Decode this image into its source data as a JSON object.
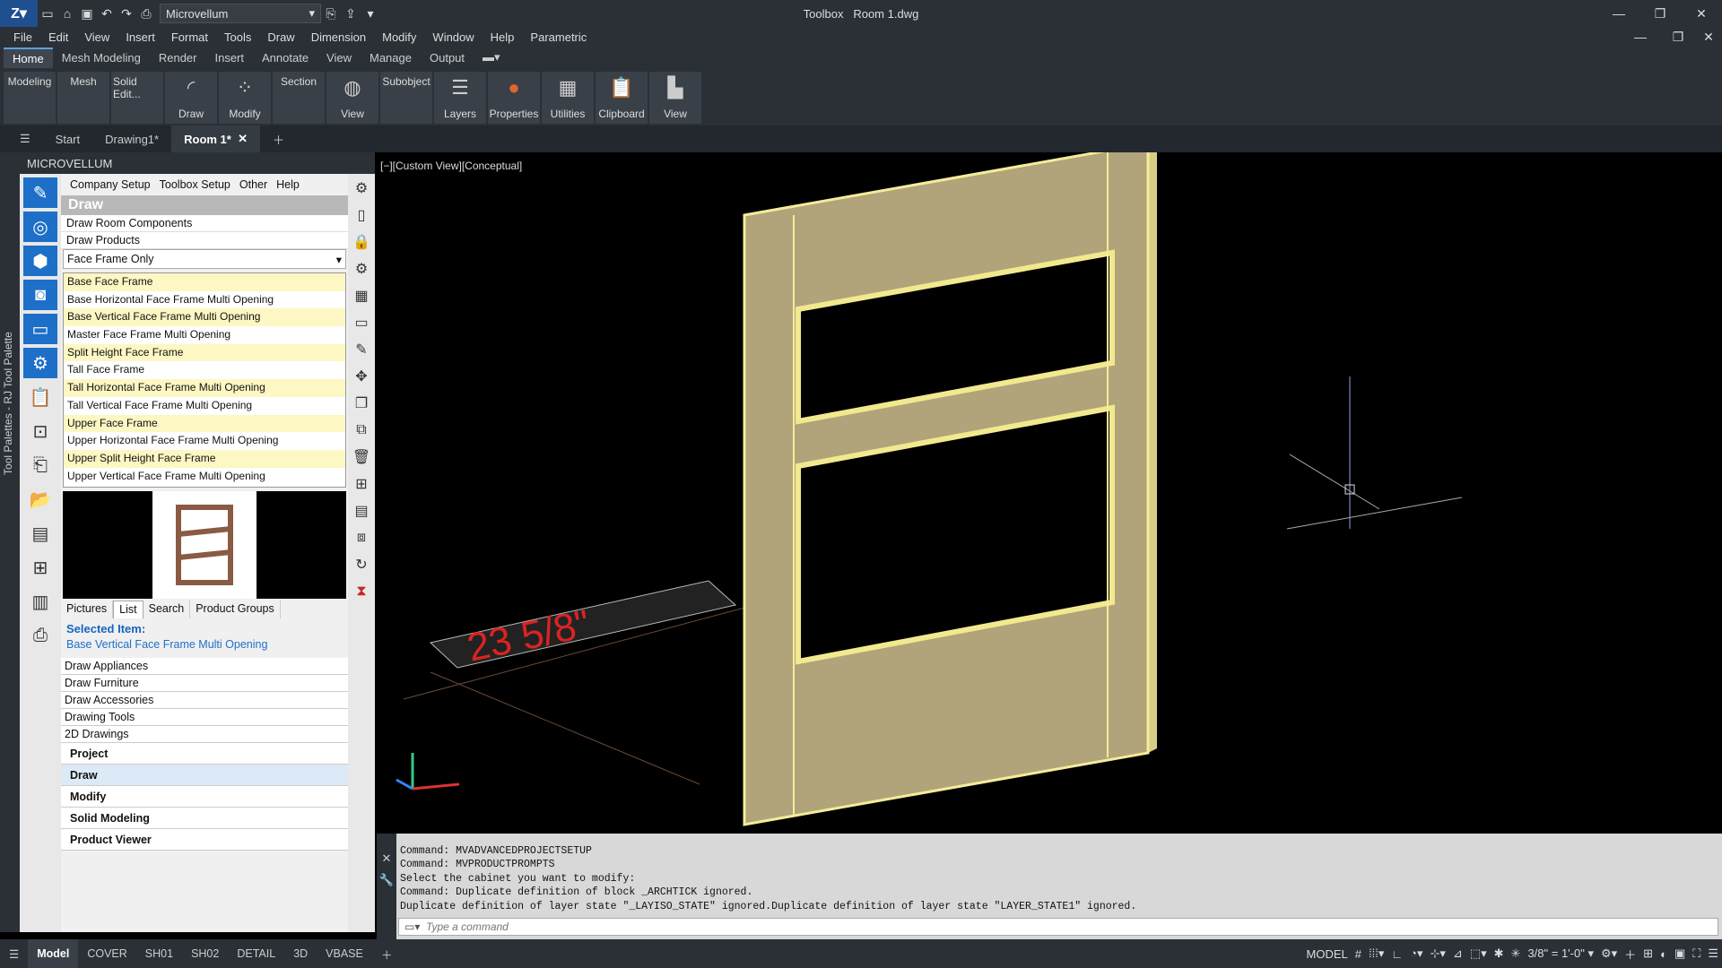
{
  "title": {
    "workspace": "Microvellum",
    "app_center": "Toolbox",
    "file": "Room 1.dwg"
  },
  "menu": [
    "File",
    "Edit",
    "View",
    "Insert",
    "Format",
    "Tools",
    "Draw",
    "Dimension",
    "Modify",
    "Window",
    "Help",
    "Parametric"
  ],
  "ribbon_tabs": [
    "Home",
    "Mesh Modeling",
    "Render",
    "Insert",
    "Annotate",
    "View",
    "Manage",
    "Output"
  ],
  "ribbon_panels": [
    "Modeling",
    "Mesh",
    "Solid Edit...",
    "Draw",
    "Modify",
    "Section",
    "View",
    "Subobject",
    "Layers",
    "Properties",
    "Utilities",
    "Clipboard",
    "View"
  ],
  "doc_tabs": [
    "Start",
    "Drawing1*",
    "Room 1*"
  ],
  "palette": {
    "header": "MICROVELLUM",
    "side_label": "Tool Palettes - RJ Tool Palette",
    "submenu": [
      "Company Setup",
      "Toolbox Setup",
      "Other",
      "Help"
    ],
    "section": "Draw",
    "draw_room": "Draw Room Components",
    "draw_products": "Draw Products",
    "filter": "Face Frame Only",
    "items": [
      "Base Face Frame",
      "Base Horizontal Face Frame Multi Opening",
      "Base Vertical Face Frame Multi Opening",
      "Master Face Frame Multi Opening",
      "Split Height Face Frame",
      "Tall Face Frame",
      "Tall Horizontal Face Frame Multi Opening",
      "Tall Vertical Face Frame Multi Opening",
      "Upper Face Frame",
      "Upper Horizontal Face Frame Multi Opening",
      "Upper Split Height Face Frame",
      "Upper Vertical Face Frame Multi Opening"
    ],
    "preview_tabs": [
      "Pictures",
      "List",
      "Search",
      "Product Groups"
    ],
    "selected_label": "Selected Item:",
    "selected_value": "Base Vertical Face Frame Multi Opening",
    "categories": [
      "Draw Appliances",
      "Draw Furniture",
      "Draw Accessories",
      "Drawing Tools",
      "2D Drawings"
    ],
    "groups": [
      "Project",
      "Draw",
      "Modify",
      "Solid Modeling",
      "Product Viewer"
    ]
  },
  "viewport": {
    "label": "[−][Custom View][Conceptual]",
    "dimension_text": "23 5/8\""
  },
  "command": {
    "history": [
      "Command: MVADVANCEDPROJECTSETUP",
      "Command: MVPRODUCTPROMPTS",
      "Select the cabinet you want to modify:",
      "Command: Duplicate definition of block _ARCHTICK  ignored.",
      "Duplicate definition of layer state \"_LAYISO_STATE\" ignored.Duplicate definition of layer state \"LAYER_STATE1\" ignored."
    ],
    "placeholder": "Type a command"
  },
  "layout_tabs": [
    "Model",
    "COVER",
    "SH01",
    "SH02",
    "DETAIL",
    "3D",
    "VBASE"
  ],
  "status": {
    "space": "MODEL",
    "scale": "3/8\" = 1'-0\""
  }
}
